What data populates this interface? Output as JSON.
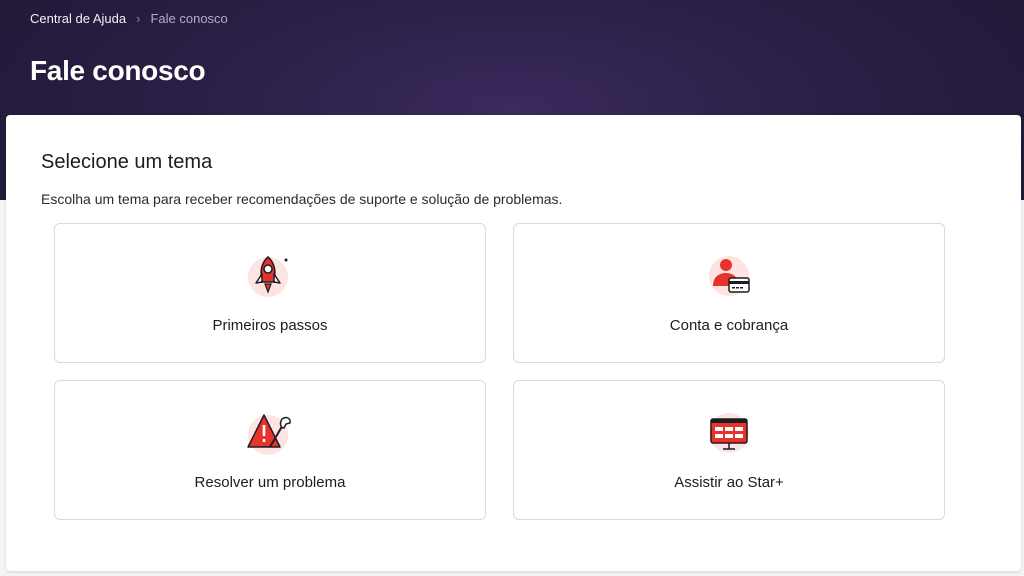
{
  "breadcrumb": {
    "home": "Central de Ajuda",
    "current": "Fale conosco"
  },
  "page": {
    "title": "Fale conosco"
  },
  "section": {
    "title": "Selecione um tema",
    "description": "Escolha um tema para receber recomendações de suporte e solução de problemas."
  },
  "topics": [
    {
      "label": "Primeiros passos",
      "icon": "rocket-icon"
    },
    {
      "label": "Conta e cobrança",
      "icon": "account-billing-icon"
    },
    {
      "label": "Resolver um problema",
      "icon": "warning-wrench-icon"
    },
    {
      "label": "Assistir ao Star+",
      "icon": "tv-screen-icon"
    }
  ],
  "colors": {
    "accent": "#e8332c",
    "icon_bg": "#fde3e1",
    "hero_bg": "#2a1f45"
  }
}
